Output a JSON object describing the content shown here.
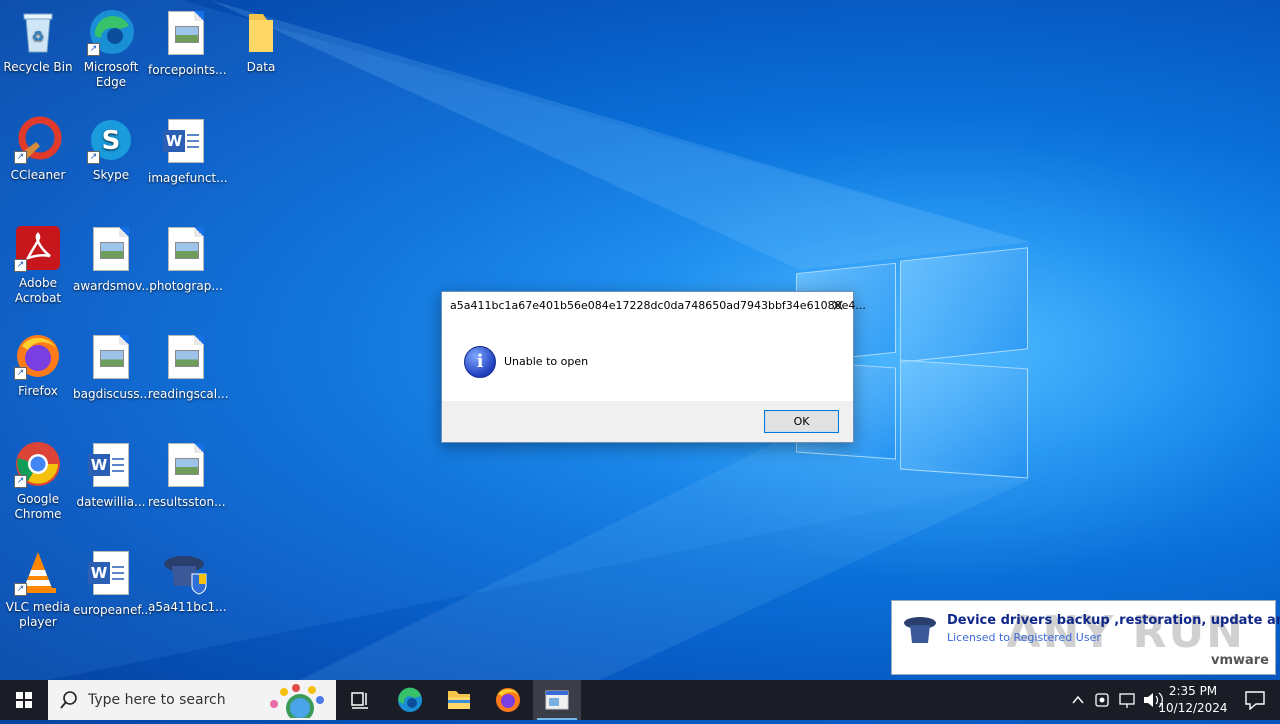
{
  "desktop": {
    "icons": [
      {
        "id": "recycle-bin",
        "label": "Recycle Bin"
      },
      {
        "id": "microsoft-edge",
        "label": "Microsoft Edge"
      },
      {
        "id": "forcepoints",
        "label": "forcepoints..."
      },
      {
        "id": "data-folder",
        "label": "Data"
      },
      {
        "id": "ccleaner",
        "label": "CCleaner"
      },
      {
        "id": "skype",
        "label": "Skype"
      },
      {
        "id": "imagefunct",
        "label": "imagefunct..."
      },
      {
        "id": "adobe-acrobat",
        "label": "Adobe Acrobat"
      },
      {
        "id": "awardsmov",
        "label": "awardsmov..."
      },
      {
        "id": "photograp",
        "label": "photograp..."
      },
      {
        "id": "firefox",
        "label": "Firefox"
      },
      {
        "id": "bagdiscuss",
        "label": "bagdiscuss..."
      },
      {
        "id": "readingscal",
        "label": "readingscal..."
      },
      {
        "id": "google-chrome",
        "label": "Google Chrome"
      },
      {
        "id": "datewillia",
        "label": "datewillia..."
      },
      {
        "id": "resultsston",
        "label": "resultsston..."
      },
      {
        "id": "vlc",
        "label": "VLC media player"
      },
      {
        "id": "europeanef",
        "label": "europeanef..."
      },
      {
        "id": "a5a411bc1",
        "label": "a5a411bc1..."
      }
    ]
  },
  "dialog": {
    "title": "a5a411bc1a67e401b56e084e17228dc0da748650ad7943bbf34e61080e4...",
    "message": "Unable to open",
    "ok_label": "OK",
    "close_glyph": "✕"
  },
  "toast": {
    "heading": "Device drivers backup ,restoration, update and rem",
    "subtext": "Licensed to Registered User",
    "vendor": "vmware",
    "watermark": "ANY RUN"
  },
  "taskbar": {
    "search_placeholder": "Type here to search",
    "time": "2:35 PM",
    "date": "10/12/2024"
  },
  "colors": {
    "desktop_blue": "#0a6fd8",
    "taskbar": "#1b1d26",
    "accent": "#0078d7"
  }
}
